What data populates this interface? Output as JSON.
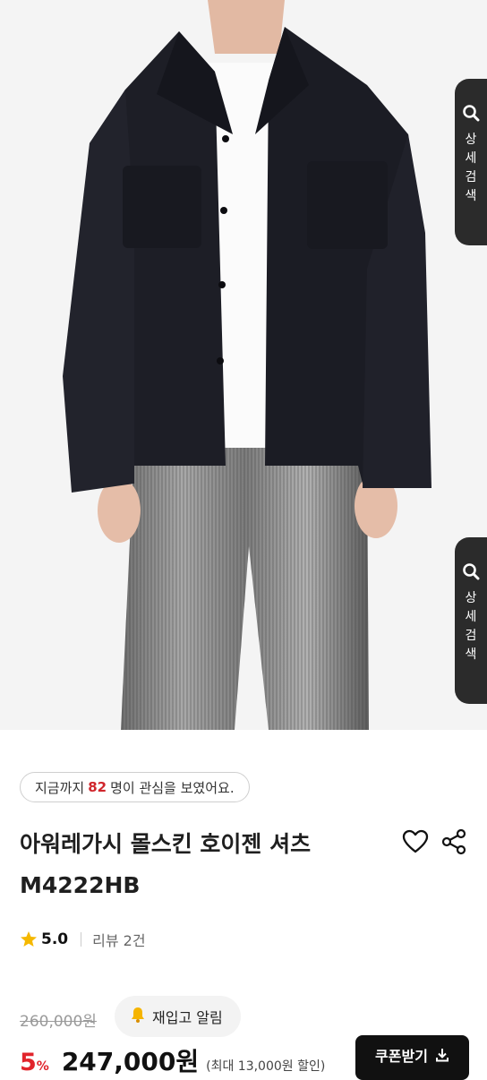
{
  "side_search": {
    "label": "상세검색",
    "icon": "search-icon"
  },
  "interest": {
    "prefix": "지금까지",
    "count": "82",
    "suffix": "명이 관심을 보였어요."
  },
  "product": {
    "title": "아워레가시 몰스킨 호이젠 셔츠 M4222HB",
    "rating": "5.0",
    "reviews": "리뷰 2건",
    "original_price": "260,000원",
    "discount_rate": "5",
    "discount_sign": "%",
    "sale_price": "247,000원",
    "max_discount": "(최대 13,000원 할인)"
  },
  "actions": {
    "restock_label": "재입고 알림",
    "coupon_label": "쿠폰받기",
    "wish_icon": "heart-icon",
    "share_icon": "share-icon"
  },
  "colors": {
    "accent_red": "#e1242b",
    "star": "#f5b800",
    "dark": "#111111"
  }
}
